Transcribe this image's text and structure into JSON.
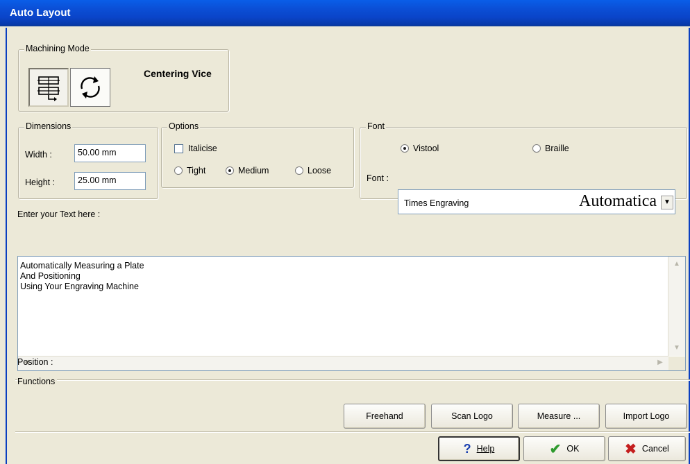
{
  "window": {
    "title": "Auto Layout"
  },
  "machining_mode": {
    "legend": "Machining Mode",
    "selected_label": "Centering Vice",
    "icons": [
      "centering-vice-icon",
      "rotary-icon"
    ]
  },
  "dimensions": {
    "legend": "Dimensions",
    "width_label": "Width :",
    "width_value": "50.00 mm",
    "height_label": "Height :",
    "height_value": "25.00 mm"
  },
  "options": {
    "legend": "Options",
    "italicise_label": "Italicise",
    "italicise_checked": false,
    "spacing": [
      "Tight",
      "Medium",
      "Loose"
    ],
    "spacing_selected": "Medium"
  },
  "font": {
    "legend": "Font",
    "type_options": [
      "Vistool",
      "Braille"
    ],
    "type_selected": "Vistool",
    "font_label": "Font :",
    "font_name": "Times Engraving",
    "preview": "Automatica"
  },
  "text_entry": {
    "label": "Enter your Text here :",
    "lines": [
      "Automatically Measuring a Plate",
      "And Positioning",
      "Using Your Engraving Machine"
    ]
  },
  "position_label": "Position :",
  "functions": {
    "legend": "Functions",
    "buttons": [
      "Freehand",
      "Scan Logo",
      "Measure ...",
      "Import Logo"
    ]
  },
  "footer": {
    "help": "Help",
    "ok": "OK",
    "cancel": "Cancel"
  },
  "colors": {
    "titlebar": "#0a4fd6",
    "dialog_bg": "#ece9d8",
    "ok_check": "#2e9a2e",
    "cancel_x": "#c41e1e",
    "help_icon": "#1a3fb0"
  }
}
